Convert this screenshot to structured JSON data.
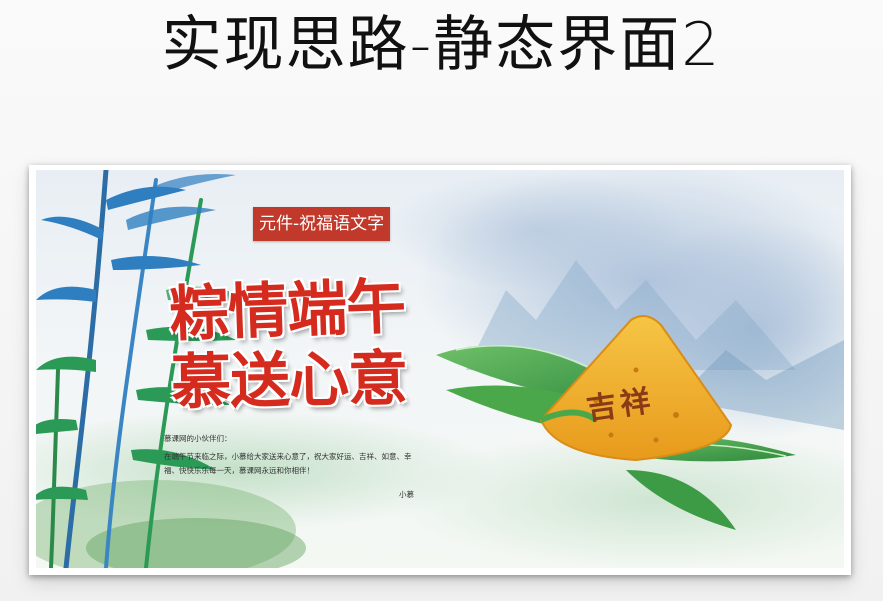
{
  "slide": {
    "title": "实现思路-静态界面2"
  },
  "banner": {
    "element_tag": "元件-祝福语文字",
    "headline_line1": "粽情端午",
    "headline_line2": "慕送心意",
    "zongzi_label": "吉祥",
    "greeting": {
      "salutation": "慕课网的小伙伴们：",
      "body": "在端午节来临之际，小慕给大家送来心意了，祝大家好运、吉祥、如意、幸福、快快乐乐每一天，慕课网永远和你相伴！",
      "signature": "小慕"
    }
  },
  "colors": {
    "headline": "#d42b1e",
    "tag_bg": "#c0392b",
    "leaf": "#3f9a3a",
    "zongzi": "#f2b431",
    "bamboo": "#2f7fc0"
  }
}
